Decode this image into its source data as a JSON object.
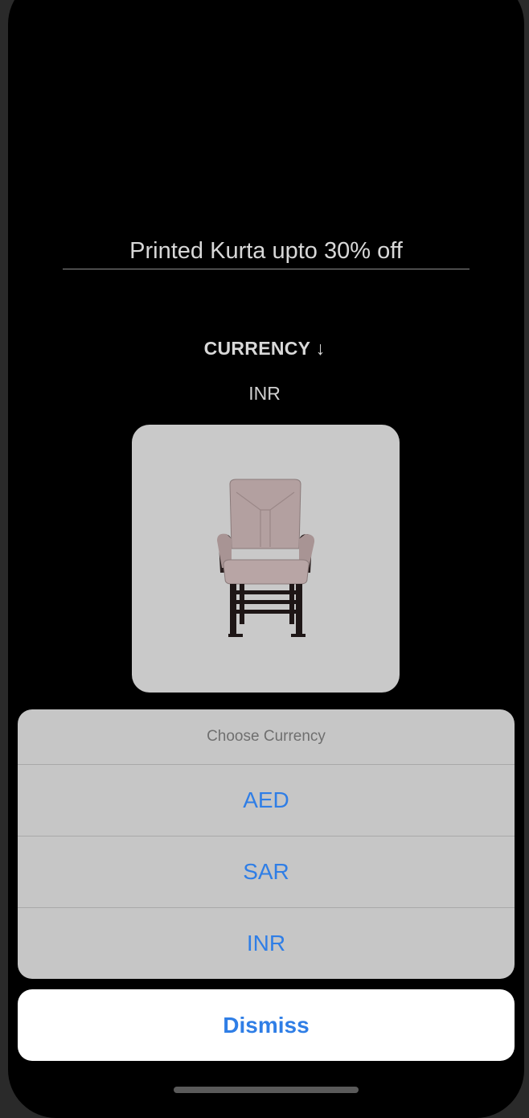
{
  "promo": {
    "text": "Printed Kurta upto 30% off"
  },
  "currency": {
    "label": "CURRENCY ↓",
    "selected": "INR"
  },
  "product": {
    "image_icon": "rocking-chair-icon"
  },
  "action_sheet": {
    "title": "Choose Currency",
    "options": [
      {
        "label": "AED"
      },
      {
        "label": "SAR"
      },
      {
        "label": "INR"
      }
    ],
    "dismiss_label": "Dismiss"
  },
  "colors": {
    "background": "#000000",
    "sheet_background": "#c6c6c6",
    "action_text": "#2f7ee6",
    "card_background": "#c9c9c9"
  }
}
